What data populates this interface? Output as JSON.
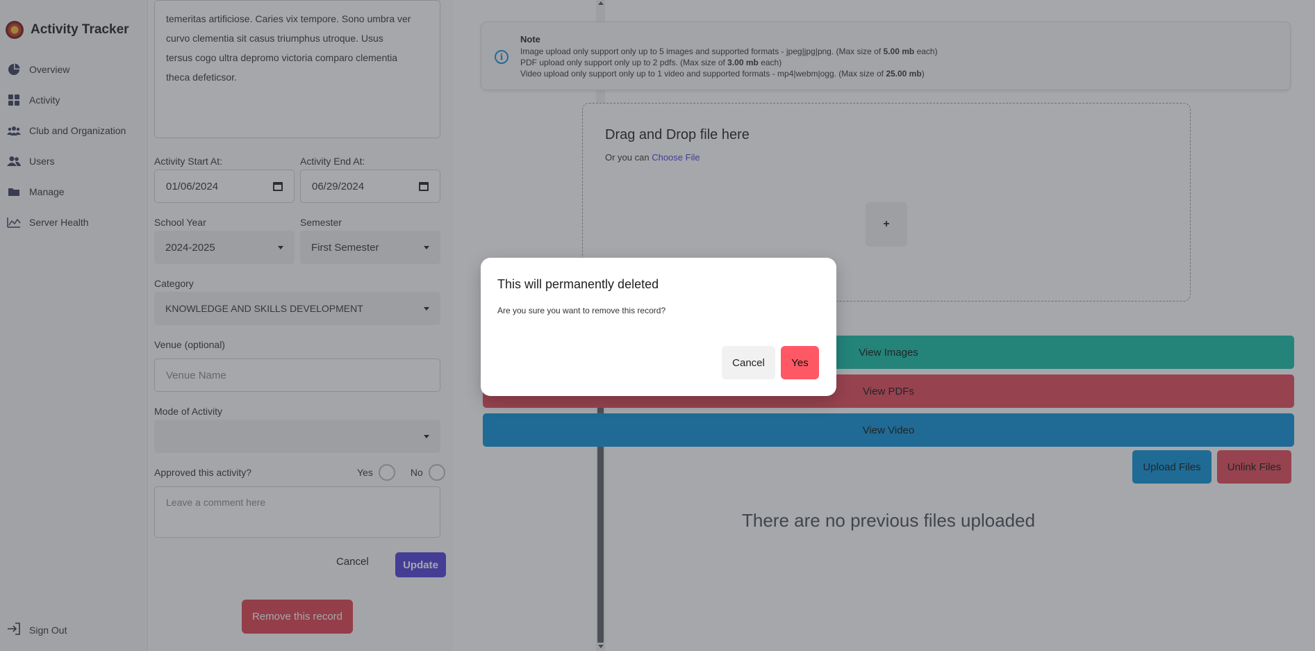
{
  "app": {
    "title": "Activity Tracker"
  },
  "sidebar": {
    "items": [
      {
        "label": "Overview",
        "icon": "pie-chart-icon"
      },
      {
        "label": "Activity",
        "icon": "grid-icon"
      },
      {
        "label": "Club and Organization",
        "icon": "group-icon"
      },
      {
        "label": "Users",
        "icon": "users-icon"
      },
      {
        "label": "Manage",
        "icon": "folder-icon"
      },
      {
        "label": "Server Health",
        "icon": "line-chart-icon"
      }
    ],
    "sign_out": "Sign Out"
  },
  "form": {
    "description_lines": [
      "temeritas artificiose. Caries vix tempore. Sono umbra ver",
      "curvo clementia sit casus triumphus utroque. Usus",
      "tersus cogo ultra depromo victoria comparo clementia",
      "theca defeticsor."
    ],
    "start_label": "Activity Start At:",
    "start_value": "01/06/2024",
    "end_label": "Activity End At:",
    "end_value": "06/29/2024",
    "school_year_label": "School Year",
    "school_year_value": "2024-2025",
    "semester_label": "Semester",
    "semester_value": "First Semester",
    "category_label": "Category",
    "category_value": "KNOWLEDGE AND SKILLS DEVELOPMENT",
    "venue_label": "Venue (optional)",
    "venue_placeholder": "Venue Name",
    "mode_label": "Mode of Activity",
    "mode_value": "",
    "approved_label": "Approved this activity?",
    "approved_yes": "Yes",
    "approved_no": "No",
    "comment_placeholder": "Leave a comment here",
    "cancel_label": "Cancel",
    "update_label": "Update",
    "remove_label": "Remove this record"
  },
  "note": {
    "title": "Note",
    "lines": [
      {
        "pre": "Image upload only support only up to 5 images and supported formats - jpeg|jpg|png. (Max size of ",
        "bold": "5.00 mb",
        "post": " each)"
      },
      {
        "pre": "PDF upload only support only up to 2 pdfs. (Max size of ",
        "bold": "3.00 mb",
        "post": " each)"
      },
      {
        "pre": "Video upload only support only up to 1 video and supported formats - mp4|webm|ogg. (Max size of ",
        "bold": "25.00 mb",
        "post": ")"
      }
    ]
  },
  "dropzone": {
    "title": "Drag and Drop file here",
    "sub_pre": "Or you can ",
    "sub_link": "Choose File",
    "plus": "+"
  },
  "files": {
    "view_images": "View Images",
    "view_pdfs": "View PDFs",
    "view_video": "View Video",
    "upload": "Upload Files",
    "unlink": "Unlink Files",
    "empty": "There are no previous files uploaded"
  },
  "modal": {
    "title": "This will permanently deleted",
    "text": "Are you sure you want to remove this record?",
    "cancel": "Cancel",
    "yes": "Yes"
  },
  "colors": {
    "accent": "#4f3fd9",
    "danger": "#e64a58",
    "teal": "#14c0a6",
    "info": "#0b92d8"
  }
}
